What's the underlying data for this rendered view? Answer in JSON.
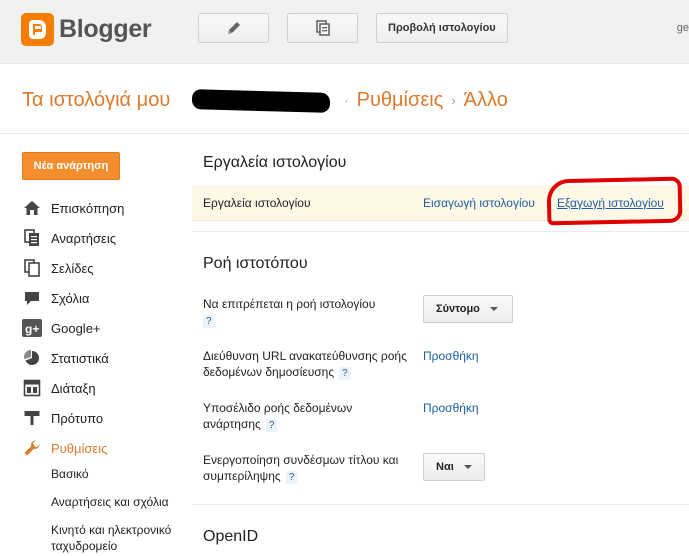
{
  "topbar": {
    "logo_text": "Blogger",
    "icons": {
      "compose": "pencil-icon",
      "posts": "copy-pages-icon"
    },
    "view_blog_label": "Προβολή ιστολογίου",
    "user_partial": "ge"
  },
  "header": {
    "my_blogs": "Τα ιστολόγιά μου",
    "separator": "›",
    "section": "Ρυθμίσεις",
    "subsection": "Άλλο"
  },
  "sidebar": {
    "new_post_label": "Νέα ανάρτηση",
    "items": [
      {
        "label": "Επισκόπηση",
        "icon": "home-icon"
      },
      {
        "label": "Αναρτήσεις",
        "icon": "posts-icon"
      },
      {
        "label": "Σελίδες",
        "icon": "pages-icon"
      },
      {
        "label": "Σχόλια",
        "icon": "comment-icon"
      },
      {
        "label": "Google+",
        "icon": "google-plus-icon"
      },
      {
        "label": "Στατιστικά",
        "icon": "pie-chart-icon"
      },
      {
        "label": "Διάταξη",
        "icon": "layout-icon"
      },
      {
        "label": "Πρότυπο",
        "icon": "template-icon"
      },
      {
        "label": "Ρυθμίσεις",
        "icon": "wrench-icon",
        "active": true
      }
    ],
    "subitems": [
      {
        "label": "Βασικό"
      },
      {
        "label": "Αναρτήσεις και σχόλια"
      },
      {
        "label": "Κινητό και ηλεκτρονικό ταχυδρομείο"
      }
    ]
  },
  "main": {
    "blog_tools": {
      "title": "Εργαλεία ιστολογίου",
      "row_label": "Εργαλεία ιστολογίου",
      "import_link": "Εισαγωγή ιστολογίου",
      "export_link": "Εξαγωγή ιστολογίου"
    },
    "site_feed": {
      "title": "Ροή ιστοτόπου",
      "allow_feed_label": "Να επιτρέπεται η ροή ιστολογίου",
      "allow_feed_value": "Σύντομο",
      "redirect_label": "Διεύθυνση URL ανακατεύθυνσης ροής δεδομένων δημοσίευσης",
      "redirect_action": "Προσθήκη",
      "footer_label": "Υποσέλιδο ροής δεδομένων ανάρτησης",
      "footer_action": "Προσθήκη",
      "enclosure_label": "Ενεργοποίηση συνδέσμων τίτλου και συμπερίληψης",
      "enclosure_value": "Ναι",
      "help": "?"
    },
    "openid": {
      "title": "OpenID"
    }
  },
  "colors": {
    "accent": "#dd7a2b",
    "link": "#1a5e9e",
    "annotation": "#e00000"
  }
}
